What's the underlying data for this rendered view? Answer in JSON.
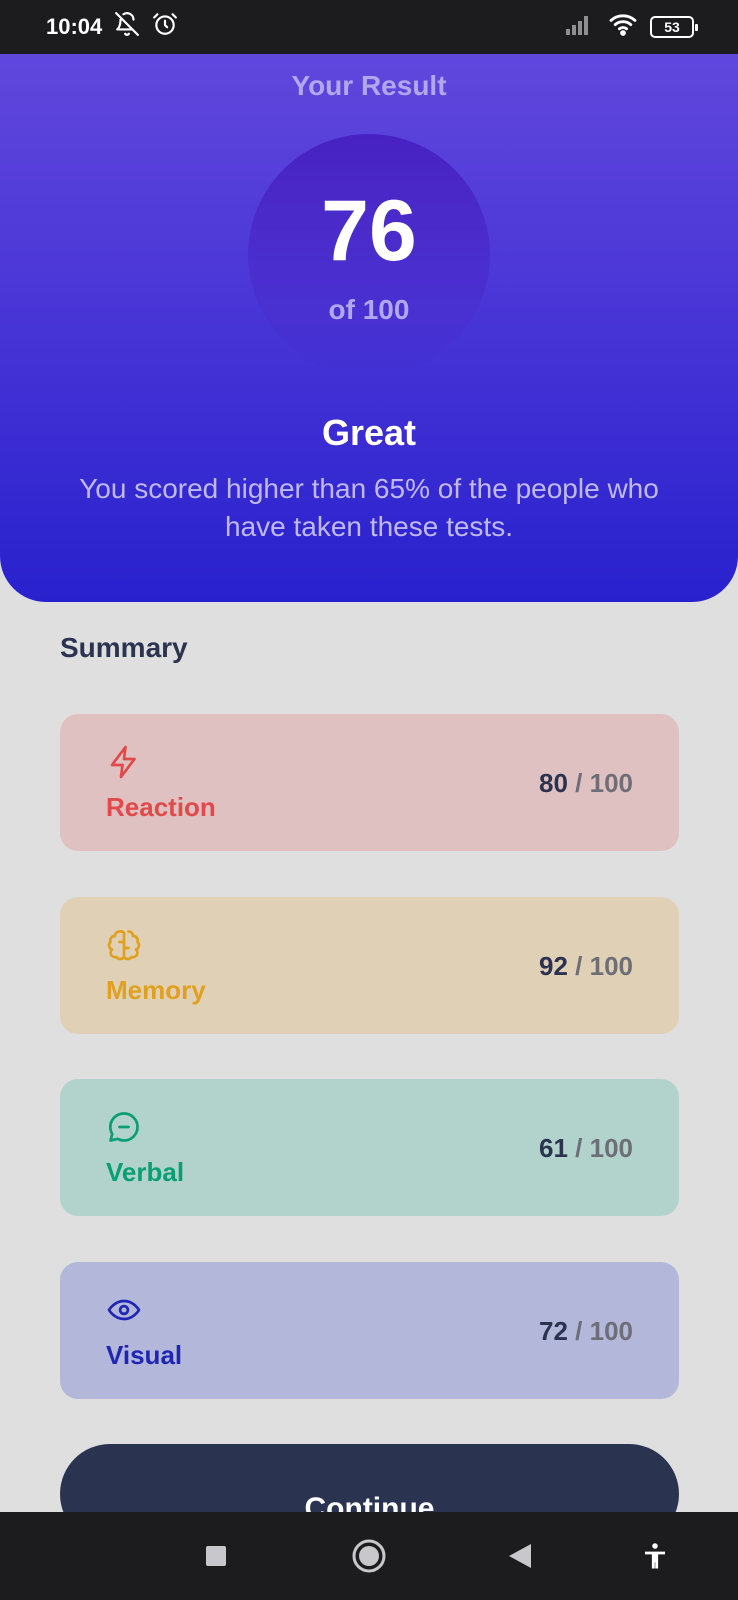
{
  "status_bar": {
    "time": "10:04",
    "icons": [
      "bell-off-icon",
      "alarm-icon",
      "signal-icon",
      "wifi-icon"
    ],
    "battery": "53"
  },
  "hero": {
    "title": "Your Result",
    "score": "76",
    "score_total": "of 100",
    "rating": "Great",
    "description": "You scored higher than 65% of the people who have taken these tests."
  },
  "summary": {
    "title": "Summary",
    "items": [
      {
        "label": "Reaction",
        "icon": "lightning-icon",
        "score": "80",
        "separator": "/",
        "max": "100",
        "color": "#e04a4a",
        "bg": "#e0c1c1"
      },
      {
        "label": "Memory",
        "icon": "brain-icon",
        "score": "92",
        "separator": "/",
        "max": "100",
        "color": "#e0a020",
        "bg": "#e0d1b6"
      },
      {
        "label": "Verbal",
        "icon": "chat-bubble-icon",
        "score": "61",
        "separator": "/",
        "max": "100",
        "color": "#0a9e74",
        "bg": "#b1d3cc"
      },
      {
        "label": "Visual",
        "icon": "eye-icon",
        "score": "72",
        "separator": "/",
        "max": "100",
        "color": "#1f26b3",
        "bg": "#b3b7d9"
      }
    ]
  },
  "continue_label": "Continue",
  "nav_bar": {
    "icons": [
      "recent-apps-icon",
      "home-icon",
      "back-icon",
      "accessibility-icon"
    ]
  }
}
